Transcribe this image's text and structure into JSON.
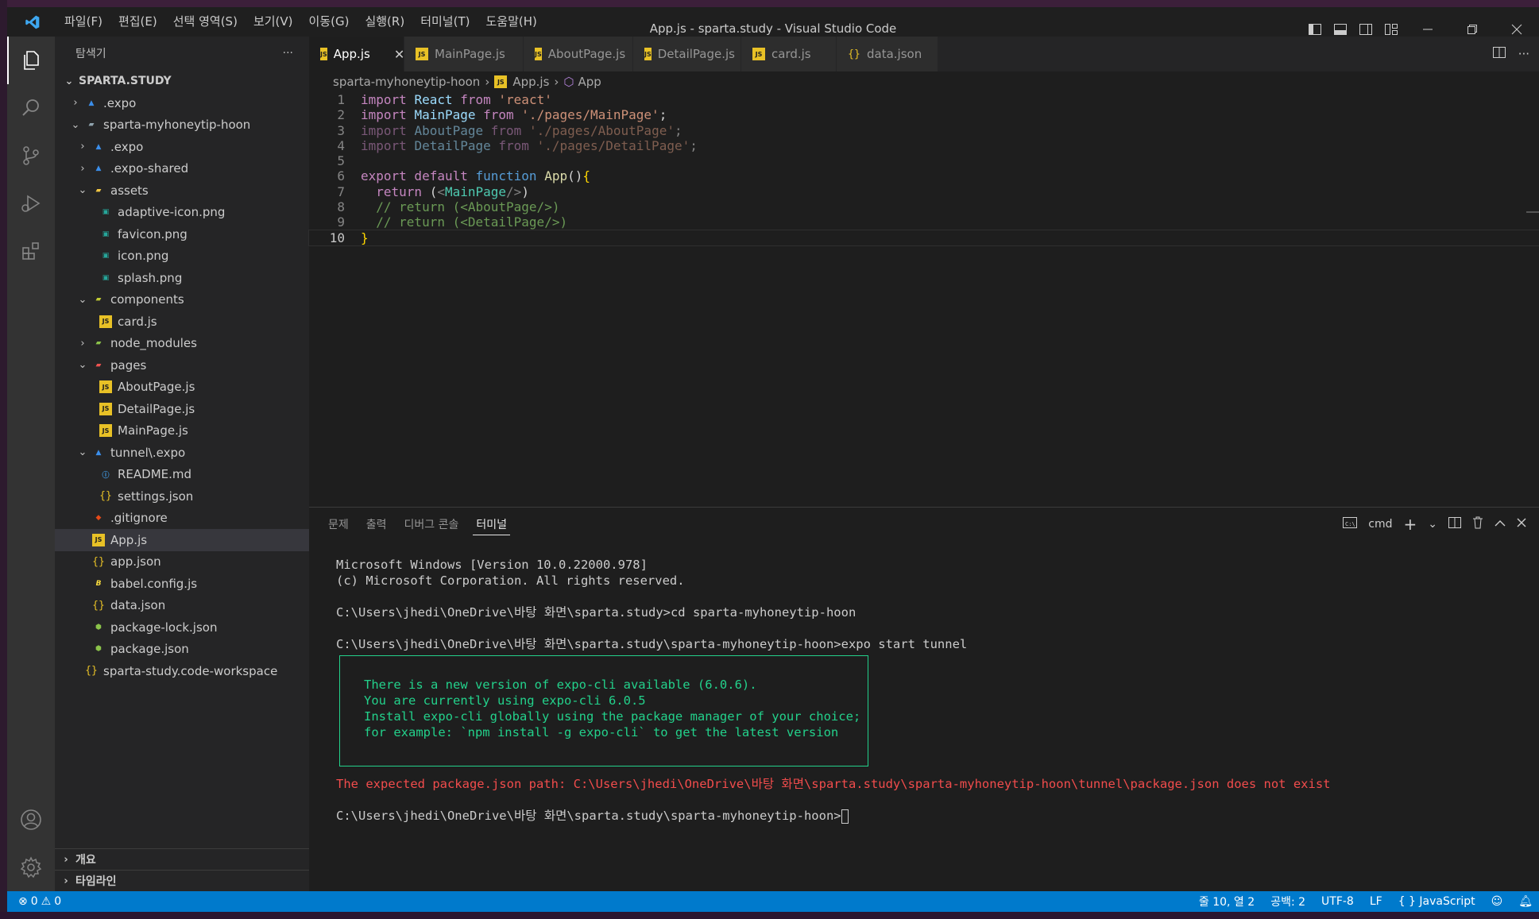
{
  "window": {
    "title": "App.js - sparta.study - Visual Studio Code"
  },
  "menu": [
    "파일(F)",
    "편집(E)",
    "선택 영역(S)",
    "보기(V)",
    "이동(G)",
    "실행(R)",
    "터미널(T)",
    "도움말(H)"
  ],
  "sidebar": {
    "title": "탐색기",
    "more": "···",
    "root": "SPARTA.STUDY",
    "tree": [
      {
        "label": ".expo",
        "depth": 0,
        "chevron": "›",
        "icon": "expo"
      },
      {
        "label": "sparta-myhoneytip-hoon",
        "depth": 0,
        "chevron": "⌄",
        "icon": "folder"
      },
      {
        "label": ".expo",
        "depth": 1,
        "chevron": "›",
        "icon": "expo"
      },
      {
        "label": ".expo-shared",
        "depth": 1,
        "chevron": "›",
        "icon": "expo"
      },
      {
        "label": "assets",
        "depth": 1,
        "chevron": "⌄",
        "icon": "folder-assets"
      },
      {
        "label": "adaptive-icon.png",
        "depth": 2,
        "chevron": "",
        "icon": "png"
      },
      {
        "label": "favicon.png",
        "depth": 2,
        "chevron": "",
        "icon": "png"
      },
      {
        "label": "icon.png",
        "depth": 2,
        "chevron": "",
        "icon": "png"
      },
      {
        "label": "splash.png",
        "depth": 2,
        "chevron": "",
        "icon": "png"
      },
      {
        "label": "components",
        "depth": 1,
        "chevron": "⌄",
        "icon": "folder-comp"
      },
      {
        "label": "card.js",
        "depth": 2,
        "chevron": "",
        "icon": "js"
      },
      {
        "label": "node_modules",
        "depth": 1,
        "chevron": "›",
        "icon": "folder-node"
      },
      {
        "label": "pages",
        "depth": 1,
        "chevron": "⌄",
        "icon": "folder-pages"
      },
      {
        "label": "AboutPage.js",
        "depth": 2,
        "chevron": "",
        "icon": "js"
      },
      {
        "label": "DetailPage.js",
        "depth": 2,
        "chevron": "",
        "icon": "js"
      },
      {
        "label": "MainPage.js",
        "depth": 2,
        "chevron": "",
        "icon": "js"
      },
      {
        "label": "tunnel\\.expo",
        "depth": 1,
        "chevron": "⌄",
        "icon": "expo"
      },
      {
        "label": "README.md",
        "depth": 2,
        "chevron": "",
        "icon": "info"
      },
      {
        "label": "settings.json",
        "depth": 2,
        "chevron": "",
        "icon": "json"
      },
      {
        "label": ".gitignore",
        "depth": 1,
        "chevron": "",
        "icon": "git"
      },
      {
        "label": "App.js",
        "depth": 1,
        "chevron": "",
        "icon": "js",
        "selected": true
      },
      {
        "label": "app.json",
        "depth": 1,
        "chevron": "",
        "icon": "json"
      },
      {
        "label": "babel.config.js",
        "depth": 1,
        "chevron": "",
        "icon": "babel"
      },
      {
        "label": "data.json",
        "depth": 1,
        "chevron": "",
        "icon": "json"
      },
      {
        "label": "package-lock.json",
        "depth": 1,
        "chevron": "",
        "icon": "npm"
      },
      {
        "label": "package.json",
        "depth": 1,
        "chevron": "",
        "icon": "npm"
      },
      {
        "label": "sparta-study.code-workspace",
        "depth": 0,
        "chevron": "",
        "icon": "json"
      }
    ],
    "panels": [
      {
        "label": "개요"
      },
      {
        "label": "타임라인"
      }
    ]
  },
  "tabs": [
    {
      "label": "App.js",
      "icon": "js",
      "active": true,
      "close": "✕"
    },
    {
      "label": "MainPage.js",
      "icon": "js"
    },
    {
      "label": "AboutPage.js",
      "icon": "js"
    },
    {
      "label": "DetailPage.js",
      "icon": "js"
    },
    {
      "label": "card.js",
      "icon": "js"
    },
    {
      "label": "data.json",
      "icon": "json"
    }
  ],
  "breadcrumb": {
    "folder": "sparta-myhoneytip-hoon",
    "file": "App.js",
    "symbol": "App"
  },
  "code": {
    "current_line": 10,
    "lines": [
      [
        {
          "t": "import ",
          "c": "kw"
        },
        {
          "t": "React",
          "c": "var"
        },
        {
          "t": " from ",
          "c": "kw"
        },
        {
          "t": "'react'",
          "c": "str"
        }
      ],
      [
        {
          "t": "import ",
          "c": "kw"
        },
        {
          "t": "MainPage",
          "c": "var"
        },
        {
          "t": " from ",
          "c": "kw"
        },
        {
          "t": "'./pages/MainPage'",
          "c": "str"
        },
        {
          "t": ";",
          "c": "punc"
        }
      ],
      [
        {
          "t": "import ",
          "c": "kw",
          "f": 1
        },
        {
          "t": "AboutPage",
          "c": "var",
          "f": 1
        },
        {
          "t": " from ",
          "c": "kw",
          "f": 1
        },
        {
          "t": "'./pages/AboutPage'",
          "c": "str",
          "f": 1
        },
        {
          "t": ";",
          "c": "punc",
          "f": 1
        }
      ],
      [
        {
          "t": "import ",
          "c": "kw",
          "f": 1
        },
        {
          "t": "DetailPage",
          "c": "var",
          "f": 1
        },
        {
          "t": " from ",
          "c": "kw",
          "f": 1
        },
        {
          "t": "'./pages/DetailPage'",
          "c": "str",
          "f": 1
        },
        {
          "t": ";",
          "c": "punc",
          "f": 1
        }
      ],
      [],
      [
        {
          "t": "export default ",
          "c": "kw"
        },
        {
          "t": "function ",
          "c": "decl"
        },
        {
          "t": "App",
          "c": "fn"
        },
        {
          "t": "()",
          "c": "punc"
        },
        {
          "t": "{",
          "c": "brace"
        }
      ],
      [
        {
          "t": "  return ",
          "c": "kw"
        },
        {
          "t": "(",
          "c": "punc"
        },
        {
          "t": "<",
          "c": "angle"
        },
        {
          "t": "MainPage",
          "c": "tag"
        },
        {
          "t": "/>",
          "c": "angle"
        },
        {
          "t": ")",
          "c": "punc"
        }
      ],
      [
        {
          "t": "  // return (<AboutPage/>)",
          "c": "comment"
        }
      ],
      [
        {
          "t": "  // return (<DetailPage/>)",
          "c": "comment"
        }
      ],
      [
        {
          "t": "}",
          "c": "brace"
        }
      ]
    ]
  },
  "panel": {
    "tabs": [
      "문제",
      "출력",
      "디버그 콘솔",
      "터미널"
    ],
    "active_tab": 3,
    "shell": "cmd",
    "terminal": {
      "lines_before": [
        "Microsoft Windows [Version 10.0.22000.978]",
        "(c) Microsoft Corporation. All rights reserved.",
        "",
        "C:\\Users\\jhedi\\OneDrive\\바탕 화면\\sparta.study>cd sparta-myhoneytip-hoon",
        "",
        "C:\\Users\\jhedi\\OneDrive\\바탕 화면\\sparta.study\\sparta-myhoneytip-hoon>expo start tunnel"
      ],
      "box_lines": [
        "There is a new version of expo-cli available (6.0.6).",
        "You are currently using expo-cli 6.0.5",
        "Install expo-cli globally using the package manager of your choice;",
        "for example: `npm install -g expo-cli` to get the latest version"
      ],
      "error": "The expected package.json path: C:\\Users\\jhedi\\OneDrive\\바탕 화면\\sparta.study\\sparta-myhoneytip-hoon\\tunnel\\package.json does not exist",
      "prompt": "C:\\Users\\jhedi\\OneDrive\\바탕 화면\\sparta.study\\sparta-myhoneytip-hoon>"
    }
  },
  "statusbar": {
    "errors": "0",
    "warnings": "0",
    "position": "줄 10, 열 2",
    "spaces": "공백: 2",
    "encoding": "UTF-8",
    "eol": "LF",
    "language": "JavaScript"
  },
  "colors": {
    "accent": "#007acc",
    "terminal_box": "#23d18b",
    "terminal_error": "#f14c4c"
  }
}
